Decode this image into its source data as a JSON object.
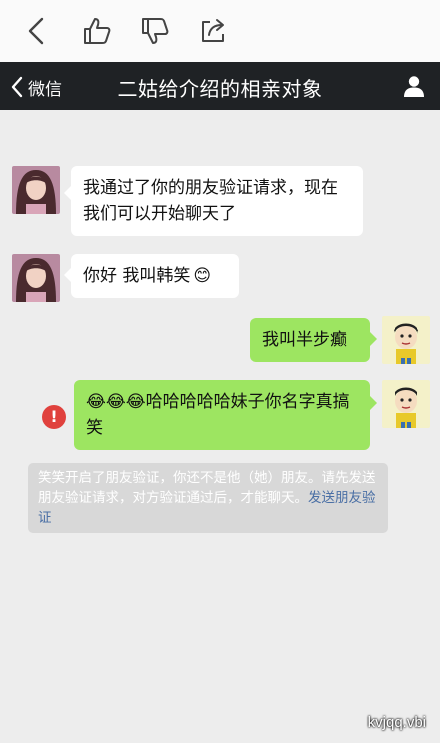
{
  "post_actions": {
    "back_icon": "chevron-left-icon",
    "like_icon": "thumbs-up-icon",
    "dislike_icon": "thumbs-down-icon",
    "share_icon": "share-icon"
  },
  "chat": {
    "back_label": "微信",
    "title": "二姑给介绍的相亲对象",
    "profile_icon": "person-icon"
  },
  "messages": [
    {
      "side": "left",
      "text": "我通过了你的朋友验证请求，现在我们可以开始聊天了"
    },
    {
      "side": "left",
      "text": "你好 我叫韩笑",
      "emoji": "😊"
    },
    {
      "side": "right",
      "text": "我叫半步癫"
    },
    {
      "side": "right",
      "emoji": "😂😂😂",
      "text": "哈哈哈哈哈妹子你名字真搞笑",
      "failed": true,
      "error_mark": "!"
    }
  ],
  "system_notice": {
    "text": "笑笑开启了朋友验证，你还不是他（她）朋友。请先发送朋友验证请求，对方验证通过后，才能聊天。",
    "link": "发送朋友验证"
  },
  "watermark": "kvjqq.vbi"
}
